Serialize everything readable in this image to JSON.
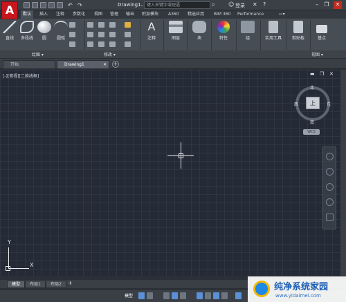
{
  "app": {
    "logo": "A",
    "doc_title": "Drawing1....",
    "search_placeholder": "键入关键字或短语",
    "signin": "登录"
  },
  "ribbon_tabs": [
    "默认",
    "插入",
    "注释",
    "参数化",
    "视图",
    "管理",
    "输出",
    "附加模块",
    "A360",
    "精选应用",
    "BIM 360",
    "Performance"
  ],
  "draw_tools": [
    "直线",
    "多段线",
    "圆",
    "圆弧"
  ],
  "big_tools": [
    "注释",
    "图层",
    "块",
    "特性",
    "组",
    "实用工具",
    "剪贴板",
    "基点"
  ],
  "panel_labels": {
    "draw": "绘图",
    "modify": "修改",
    "view": "视图"
  },
  "doc_tabs": {
    "start": "开始",
    "drawing": "Drawing1"
  },
  "viewport": {
    "controls": "[-][俯视][二维线框]"
  },
  "viewcube": {
    "north": "北",
    "south": "南",
    "east": "东",
    "west": "西",
    "top": "上",
    "wcs": "WCS"
  },
  "ucs": {
    "y": "Y",
    "x": "X"
  },
  "layout_tabs": [
    "模型",
    "布局1",
    "布局2"
  ],
  "status": {
    "model": "模型"
  },
  "watermark": {
    "line1": "纯净系统家园",
    "line2": "www.yidaimei.com"
  }
}
